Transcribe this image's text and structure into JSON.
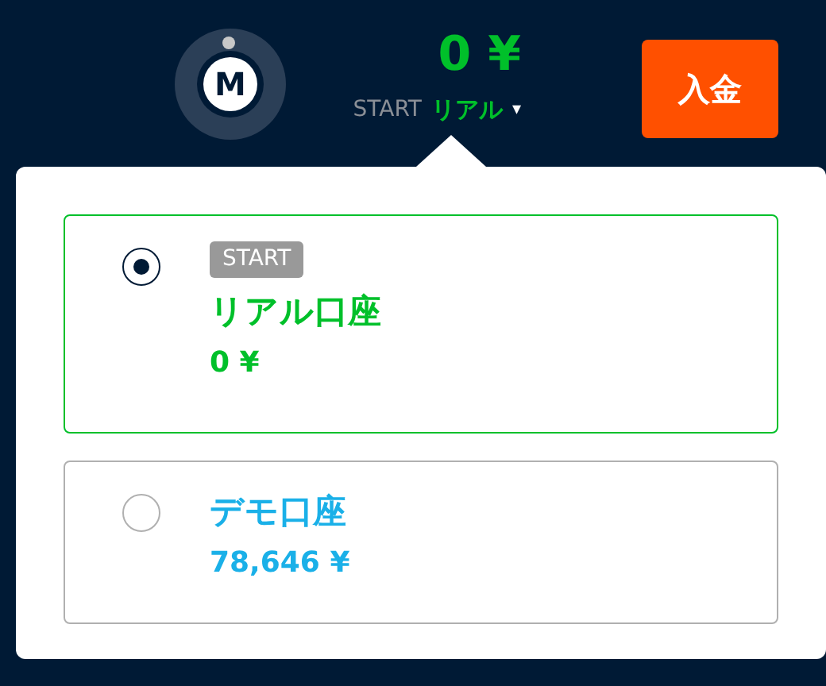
{
  "header": {
    "avatar_letter": "M",
    "balance": "0 ¥",
    "account_badge": "START",
    "account_name": "リアル",
    "dropdown_caret": "▾",
    "deposit_button": "入金"
  },
  "accounts": [
    {
      "badge": "START",
      "name": "リアル口座",
      "balance": "0 ¥",
      "selected": true,
      "color": "#00c02a"
    },
    {
      "name": "デモ口座",
      "balance": "78,646 ¥",
      "selected": false,
      "color": "#1ab0e8"
    }
  ]
}
